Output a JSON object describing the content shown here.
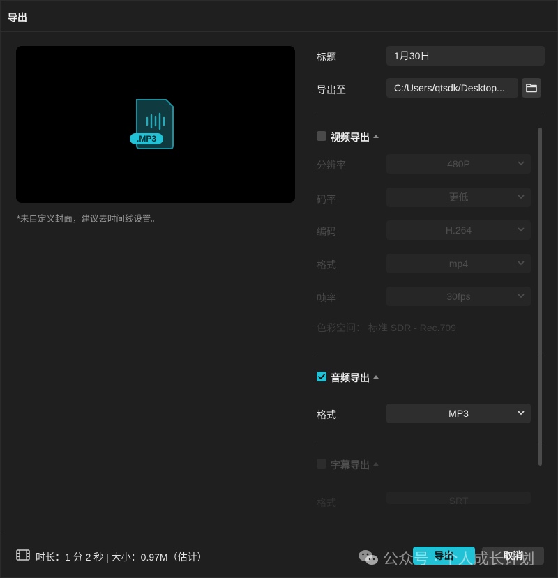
{
  "window": {
    "title": "导出"
  },
  "preview": {
    "badge": ".MP3",
    "cover_note": "*未自定义封面，建议去时间线设置。"
  },
  "title_field": {
    "label": "标题",
    "value": "1月30日"
  },
  "export_to": {
    "label": "导出至",
    "value": "C:/Users/qtsdk/Desktop..."
  },
  "video_export": {
    "header": "视频导出",
    "checked": false,
    "settings": [
      {
        "label": "分辨率",
        "value": "480P"
      },
      {
        "label": "码率",
        "value": "更低"
      },
      {
        "label": "编码",
        "value": "H.264"
      },
      {
        "label": "格式",
        "value": "mp4"
      },
      {
        "label": "帧率",
        "value": "30fps"
      }
    ],
    "colorspace": "色彩空间：  标准 SDR - Rec.709"
  },
  "audio_export": {
    "header": "音频导出",
    "checked": true,
    "format_label": "格式",
    "format_value": "MP3"
  },
  "subtitle_export": {
    "header": "字幕导出",
    "checked": false,
    "format_label": "格式",
    "format_value": "SRT"
  },
  "footer": {
    "info": "时长：1 分 2 秒 | 大小：0.97M（估计）",
    "export_label": "导出",
    "cancel_label": "取消"
  },
  "watermark": {
    "text": "公众号 · 个人成长计划"
  },
  "colors": {
    "accent": "#22c2d6",
    "background": "#1f1f1f",
    "field": "#2e2e2e"
  }
}
